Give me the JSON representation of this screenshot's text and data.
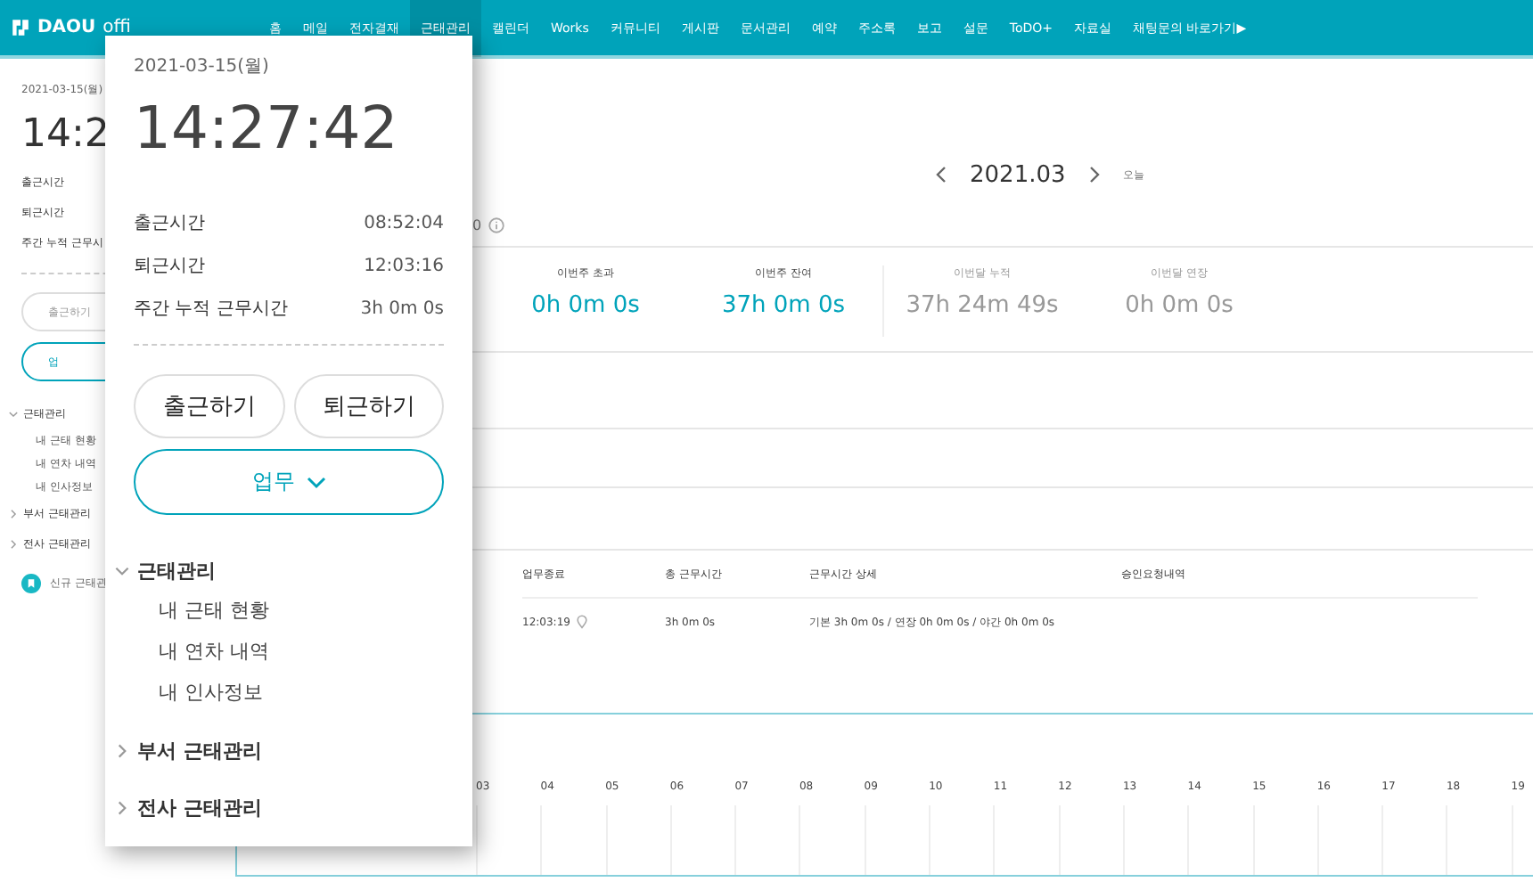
{
  "logo": {
    "brand": "DAOU",
    "suffix": "offi"
  },
  "nav": [
    {
      "label": "홈",
      "selected": false
    },
    {
      "label": "메일",
      "selected": false
    },
    {
      "label": "전자결재",
      "selected": false
    },
    {
      "label": "근태관리",
      "selected": true
    },
    {
      "label": "캘린더",
      "selected": false
    },
    {
      "label": "Works",
      "selected": false
    },
    {
      "label": "커뮤니티",
      "selected": false
    },
    {
      "label": "게시판",
      "selected": false
    },
    {
      "label": "문서관리",
      "selected": false
    },
    {
      "label": "예약",
      "selected": false
    },
    {
      "label": "주소록",
      "selected": false
    },
    {
      "label": "보고",
      "selected": false
    },
    {
      "label": "설문",
      "selected": false
    },
    {
      "label": "ToDO+",
      "selected": false
    },
    {
      "label": "자료실",
      "selected": false
    },
    {
      "label": "채팅문의 바로가기▶",
      "selected": false
    }
  ],
  "sidebar": {
    "date": "2021-03-15(월)",
    "clock": "14:2",
    "rows": [
      "출근시간",
      "퇴근시간",
      "주간 누적 근무시"
    ],
    "checkin_button": "출근하기",
    "work_button": "업",
    "menu": [
      {
        "label": "근태관리",
        "expanded": true,
        "children": [
          {
            "label": "내 근태 현황"
          },
          {
            "label": "내 연차 내역"
          },
          {
            "label": "내 인사정보"
          }
        ]
      },
      {
        "label": "부서 근태관리",
        "expanded": false
      },
      {
        "label": "전사 근태관리",
        "expanded": false
      }
    ],
    "new_link": "신규 근태관"
  },
  "main": {
    "month": "2021.03",
    "today": "오늘",
    "partial_value": "0",
    "stats": [
      {
        "label": "이번주 초과",
        "value": "0h 0m 0s",
        "highlight": true
      },
      {
        "label": "이번주 잔여",
        "value": "37h 0m 0s",
        "highlight": true
      },
      {
        "label": "이번달 누적",
        "value": "37h 24m 49s",
        "highlight": false
      },
      {
        "label": "이번달 연장",
        "value": "0h 0m 0s",
        "highlight": false
      }
    ],
    "table": {
      "columns": [
        "업무종료",
        "총 근무시간",
        "근무시간 상세",
        "승인요청내역"
      ],
      "rows": [
        [
          "12:03:19",
          "3h 0m 0s",
          "기본 3h 0m 0s / 연장 0h 0m 0s / 야간 0h 0m 0s",
          ""
        ]
      ]
    },
    "hours": [
      "03",
      "04",
      "05",
      "06",
      "07",
      "08",
      "09",
      "10",
      "11",
      "12",
      "13",
      "14",
      "15",
      "16",
      "17",
      "18",
      "19"
    ]
  },
  "popup": {
    "date": "2021-03-15(월)",
    "clock": "14:27:42",
    "rows": [
      {
        "label": "출근시간",
        "value": "08:52:04"
      },
      {
        "label": "퇴근시간",
        "value": "12:03:16"
      },
      {
        "label": "주간 누적 근무시간",
        "value": "3h 0m 0s"
      }
    ],
    "buttons": [
      "출근하기",
      "퇴근하기"
    ],
    "work_button": "업무",
    "menu": [
      {
        "label": "근태관리",
        "expanded": true,
        "children": [
          {
            "label": "내 근태 현황"
          },
          {
            "label": "내 연차 내역"
          },
          {
            "label": "내 인사정보"
          }
        ]
      },
      {
        "label": "부서 근태관리",
        "expanded": false
      },
      {
        "label": "전사 근태관리",
        "expanded": false
      }
    ]
  }
}
